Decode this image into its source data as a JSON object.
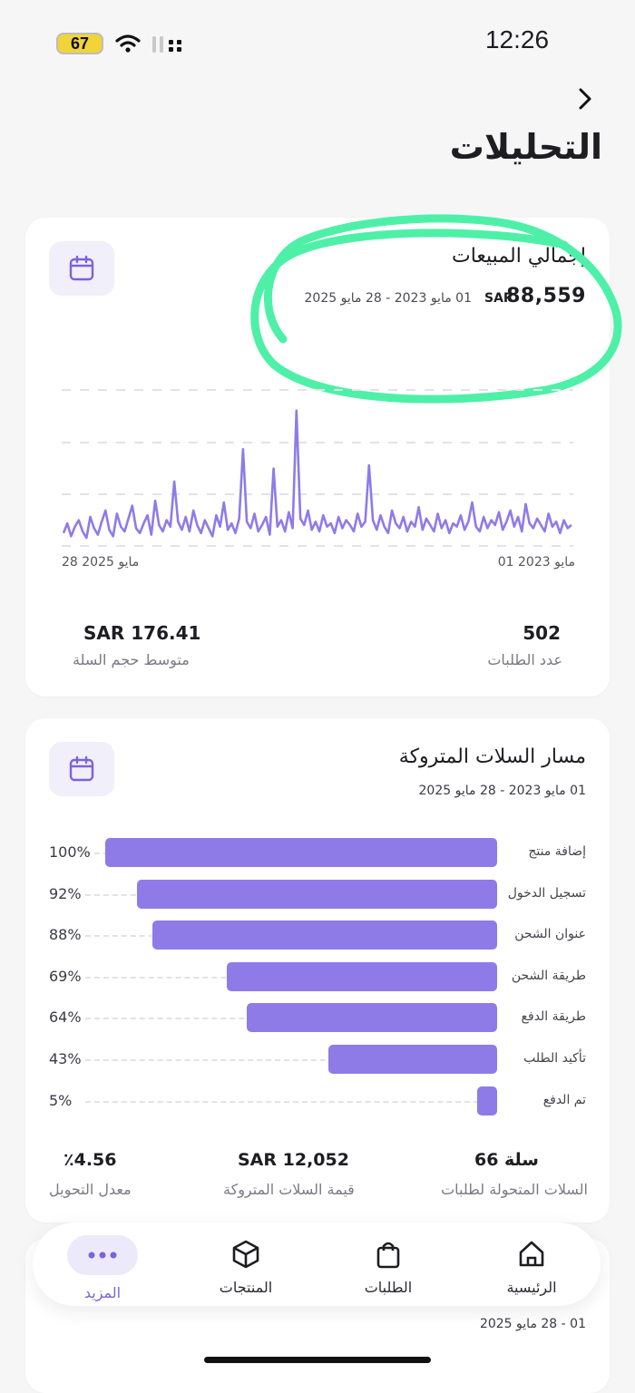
{
  "status_bar": {
    "battery": "67",
    "time": "12:26"
  },
  "header": {
    "title": "التحليلات"
  },
  "sales_card": {
    "title": "إجمالي المبيعات",
    "amount": "88,559",
    "currency": "SAR",
    "date_range": "01 مايو 2023 - 28 مايو 2025",
    "x_start_label": "01 مايو 2023",
    "x_end_label": "28 مايو 2025",
    "orders_value": "502",
    "orders_label": "عدد الطلبات",
    "avg_value": "SAR 176.41",
    "avg_label": "متوسط حجم السلة",
    "chart_data": {
      "type": "line",
      "series": [
        {
          "values": [
            8,
            14,
            6,
            12,
            16,
            9,
            5,
            18,
            11,
            7,
            15,
            22,
            10,
            6,
            20,
            12,
            9,
            17,
            25,
            11,
            8,
            14,
            19,
            7,
            28,
            13,
            9,
            16,
            12,
            40,
            15,
            10,
            18,
            9,
            22,
            13,
            8,
            16,
            11,
            6,
            19,
            12,
            27,
            10,
            14,
            8,
            17,
            60,
            15,
            11,
            20,
            9,
            13,
            18,
            7,
            48,
            12,
            16,
            9,
            21,
            11,
            84,
            17,
            13,
            22,
            10,
            15,
            9,
            19,
            12,
            14,
            8,
            18,
            11,
            16,
            13,
            9,
            20,
            12,
            15,
            50,
            16,
            10,
            19,
            12,
            8,
            22,
            14,
            11,
            18,
            9,
            15,
            12,
            24,
            10,
            17,
            13,
            9,
            20,
            11,
            16,
            8,
            14,
            12,
            19,
            10,
            15,
            27,
            12,
            9,
            18,
            11,
            16,
            13,
            21,
            10,
            15,
            22,
            12,
            18,
            9,
            26,
            14,
            11,
            17,
            13,
            9,
            20,
            12,
            15,
            8,
            16,
            11,
            13
          ]
        }
      ]
    }
  },
  "funnel_card": {
    "title": "مسار السلات المتروكة",
    "date_range": "01 مايو 2023 - 28 مايو 2025",
    "steps": [
      {
        "label": "إضافة منتج",
        "pct": "100%",
        "value": 100
      },
      {
        "label": "تسجيل الدخول",
        "pct": "92%",
        "value": 92
      },
      {
        "label": "عنوان الشحن",
        "pct": "88%",
        "value": 88
      },
      {
        "label": "طريقة الشحن",
        "pct": "69%",
        "value": 69
      },
      {
        "label": "طريقة الدفع",
        "pct": "64%",
        "value": 64
      },
      {
        "label": "تأكيد الطلب",
        "pct": "43%",
        "value": 43
      },
      {
        "label": "تم الدفع",
        "pct": "5%",
        "value": 5
      }
    ],
    "stats": [
      {
        "value": "66 سلة",
        "label": "السلات المتحولة لطلبات"
      },
      {
        "value": "SAR 12,052",
        "label": "قيمة السلات المتروكة"
      },
      {
        "value": "٪4.56",
        "label": "معدل التحويل"
      }
    ]
  },
  "peek_card": {
    "date_range": "01 - 28 مايو 2025"
  },
  "bottom_nav": {
    "items": [
      {
        "label": "الرئيسية",
        "icon": "home-icon"
      },
      {
        "label": "الطلبات",
        "icon": "bag-icon"
      },
      {
        "label": "المنتجات",
        "icon": "box-icon"
      },
      {
        "label": "المزيد",
        "icon": "more-icon",
        "active": true
      }
    ]
  },
  "colors": {
    "accent": "#8f7be7",
    "highlight": "#4ef0a8",
    "active_nav_bg": "#ece9fb"
  }
}
